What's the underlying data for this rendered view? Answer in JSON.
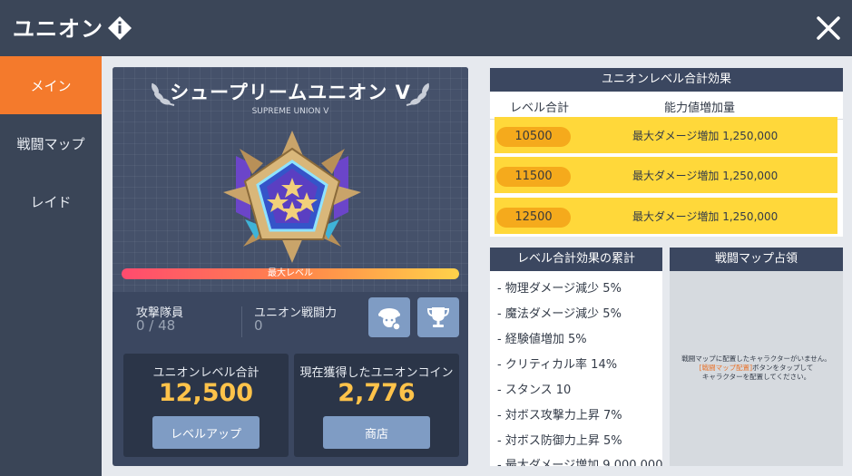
{
  "header": {
    "title": "ユニオン",
    "info_icon": "info-diamond-icon",
    "close_icon": "close-icon"
  },
  "sidebar": {
    "items": [
      {
        "label": "メイン",
        "active": true
      },
      {
        "label": "戦闘マップ",
        "active": false
      },
      {
        "label": "レイド",
        "active": false
      }
    ]
  },
  "rank": {
    "name": "シュープリームユニオン V",
    "subtitle": "SUPREME UNION V",
    "max_label": "最大レベル",
    "progress_percent": 100
  },
  "stats": {
    "squad_label": "攻撃隊員",
    "squad_value": "0 / 48",
    "power_label": "ユニオン戦闘力",
    "power_value": "0",
    "character_icon": "character-icon",
    "trophy_icon": "trophy-icon"
  },
  "level_box": {
    "label": "ユニオンレベル合計",
    "value": "12,500",
    "button": "レベルアップ"
  },
  "coin_box": {
    "label": "現在獲得したユニオンコイン",
    "value": "2,776",
    "button": "商店"
  },
  "effects": {
    "title": "ユニオンレベル合計効果",
    "col_level": "レベル合計",
    "col_effect": "能力値増加量",
    "rows": [
      {
        "level": "10500",
        "effect": "最大ダメージ増加 1,250,000"
      },
      {
        "level": "11500",
        "effect": "最大ダメージ増加 1,250,000"
      },
      {
        "level": "12500",
        "effect": "最大ダメージ増加 1,250,000"
      }
    ]
  },
  "cumulative": {
    "title": "レベル合計効果の累計",
    "items": [
      "- 物理ダメージ減少 5%",
      "- 魔法ダメージ減少 5%",
      "- 経験値増加 5%",
      "- クリティカル率 14%",
      "- スタンス 10",
      "- 対ボス攻撃力上昇 7%",
      "- 対ボス防御力上昇 5%",
      "- 最大ダメージ増加 9,000,000"
    ]
  },
  "battle_map": {
    "title": "戦闘マップ占領",
    "message_line1": "戦闘マップに配置したキャラクターがいません。",
    "message_highlight": "[戦闘マップ配置]",
    "message_line2_rest": "ボタンをタップして",
    "message_line3": "キャラクターを配置してください。"
  },
  "colors": {
    "accent_orange": "#f47a2c",
    "gold": "#ffc34a",
    "yellow_row": "#ffd83a",
    "panel_dark": "#3b4760"
  }
}
